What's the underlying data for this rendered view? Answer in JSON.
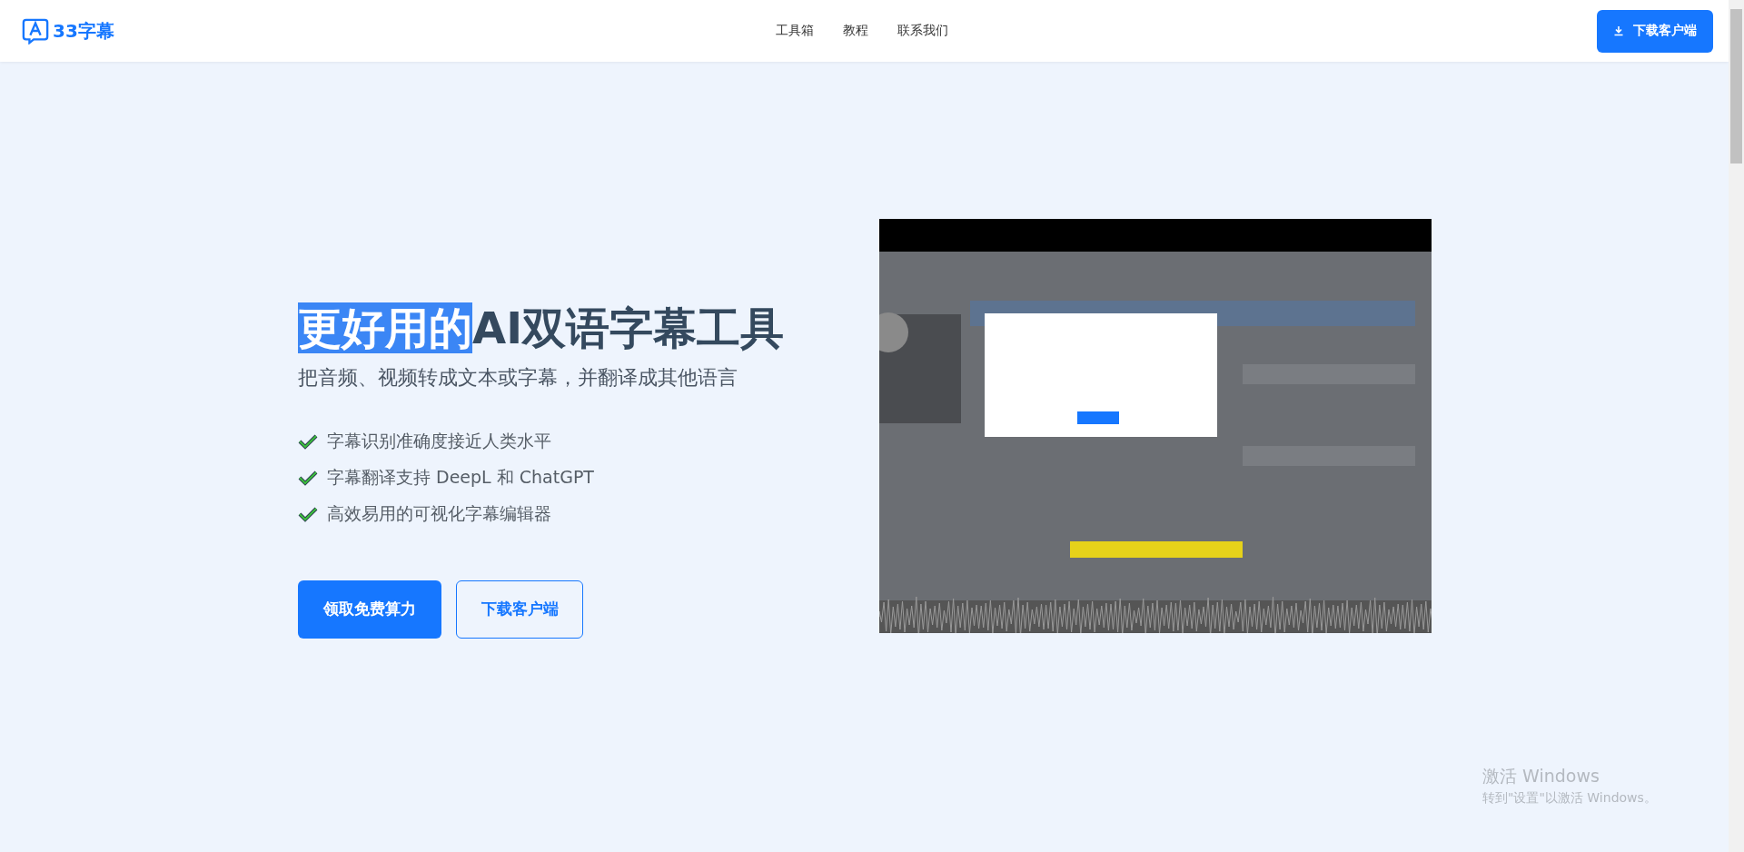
{
  "header": {
    "logo": "33字幕",
    "nav": [
      "工具箱",
      "教程",
      "联系我们"
    ],
    "download_button": "下载客户端"
  },
  "hero": {
    "title": {
      "selected_text": "更好用的",
      "text": "AI双语字幕工具"
    },
    "subtitle": "把音频、视频转成文本或字幕，并翻译成其他语言",
    "features": [
      "字幕识别准确度接近人类水平",
      "字幕翻译支持 DeepL 和 ChatGPT",
      "高效易用的可视化字幕编辑器"
    ],
    "buttons": [
      {
        "label": "领取免费算力",
        "kind": "primary"
      },
      {
        "label": "下载客户端",
        "kind": "outline"
      }
    ]
  },
  "os_notice": {
    "title": "激活 Windows",
    "text": "转到\"设置\"以激活 Windows。"
  }
}
